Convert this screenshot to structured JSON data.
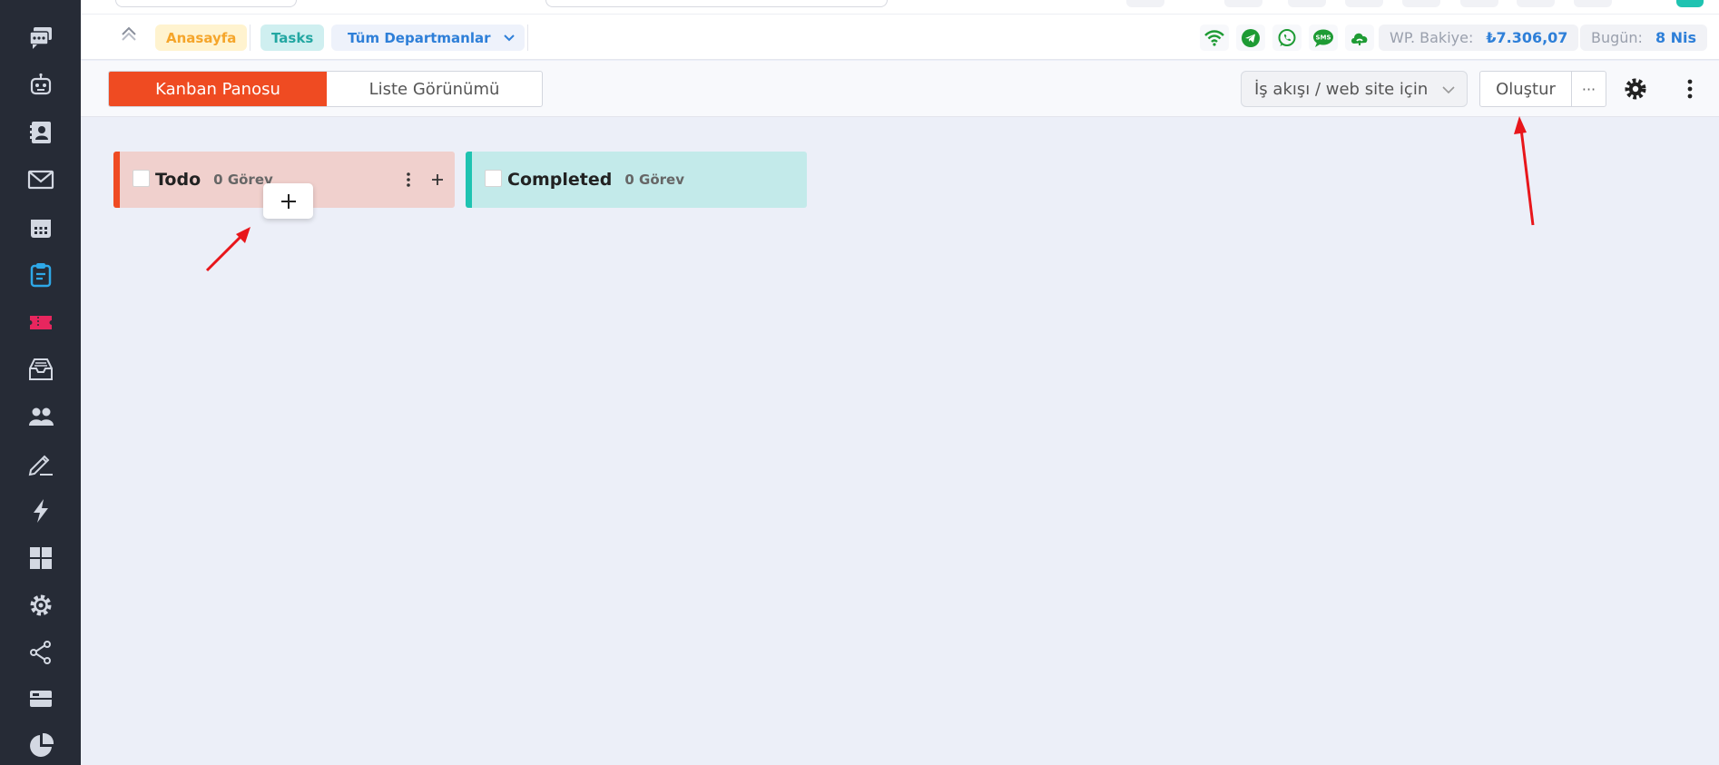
{
  "sidebar": {
    "items": [
      {
        "name": "chat-icon"
      },
      {
        "name": "bot-icon"
      },
      {
        "name": "contacts-icon"
      },
      {
        "name": "mail-icon"
      },
      {
        "name": "calendar-icon"
      },
      {
        "name": "tasks-icon",
        "active": true
      },
      {
        "name": "ticket-icon"
      },
      {
        "name": "inbox-icon"
      },
      {
        "name": "users-icon"
      },
      {
        "name": "edit-icon"
      },
      {
        "name": "automation-icon"
      },
      {
        "name": "apps-icon"
      },
      {
        "name": "settings-gear-icon"
      },
      {
        "name": "share-icon"
      },
      {
        "name": "card-icon"
      },
      {
        "name": "reports-icon"
      }
    ]
  },
  "header": {
    "breadcrumb": {
      "home": "Anasayfa",
      "current": "Tasks"
    },
    "department_select": "Tüm Departmanlar",
    "status_icons": [
      "wifi-icon",
      "telegram-icon",
      "whatsapp-icon",
      "sms-icon",
      "cloud-icon"
    ],
    "wp_balance": {
      "label": "WP. Bakiye:",
      "value": "₺7.306,07"
    },
    "today": {
      "label": "Bugün:",
      "value": "8 Nis"
    }
  },
  "toolbar": {
    "views": [
      {
        "label": "Kanban Panosu",
        "active": true
      },
      {
        "label": "Liste Görünümü",
        "active": false
      }
    ],
    "workflow_select": "İş akışı / web site için",
    "create_label": "Oluştur",
    "more_label": "···"
  },
  "board": {
    "columns": [
      {
        "title": "Todo",
        "count": "0 Görev",
        "color": "#ef4b22"
      },
      {
        "title": "Completed",
        "count": "0 Görev",
        "color": "#1fc3b1"
      }
    ]
  },
  "colors": {
    "accent": "#ef4b22",
    "sidebar_bg": "#262b36",
    "link_blue": "#2e7fd8",
    "teal": "#1fc3b1",
    "annotation_red": "#e8161b"
  }
}
